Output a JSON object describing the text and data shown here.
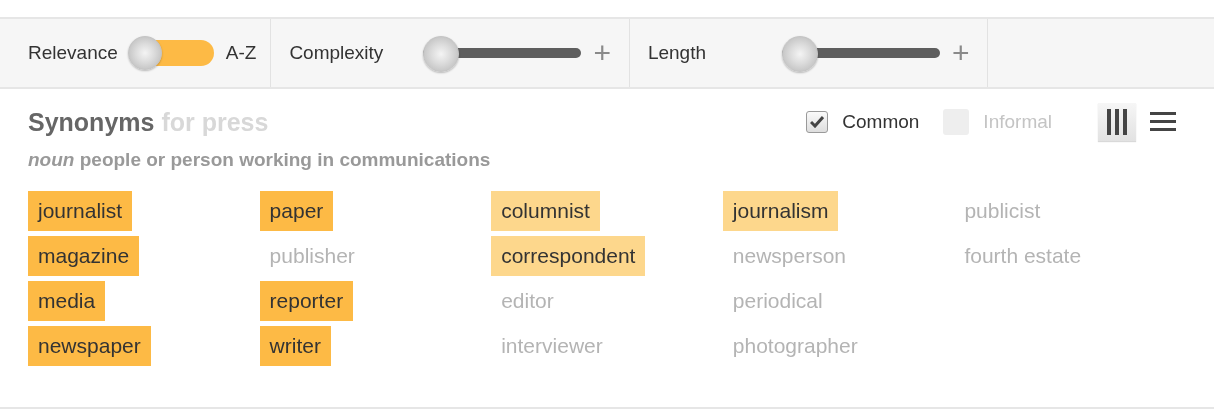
{
  "toolbar": {
    "sort_toggle": {
      "left_label": "Relevance",
      "right_label": "A-Z",
      "on": true
    },
    "sliders": [
      {
        "label": "Complexity",
        "level": 0,
        "plus": "+"
      },
      {
        "label": "Length",
        "level": 0,
        "plus": "+"
      }
    ]
  },
  "heading": {
    "title": "Synonyms",
    "subtitle": "for press"
  },
  "filters": [
    {
      "label": "Common",
      "checked": true
    },
    {
      "label": "Informal",
      "checked": false
    }
  ],
  "view_buttons": [
    {
      "kind": "columns",
      "selected": true
    },
    {
      "kind": "list",
      "selected": false
    }
  ],
  "definition": "*noun* people or person working in communications",
  "word_columns": [
    [
      {
        "text": "journalist",
        "color": "#fdba45"
      },
      {
        "text": "magazine",
        "color": "#fdba45"
      },
      {
        "text": "media",
        "color": "#fdba45"
      },
      {
        "text": "newspaper",
        "color": "#fdba45"
      }
    ],
    [
      {
        "text": "paper",
        "color": "#fdba45"
      },
      {
        "text": "publisher",
        "color": "#b4b4b4"
      },
      {
        "text": "reporter",
        "color": "#fdba45"
      },
      {
        "text": "writer",
        "color": "#fdba45"
      }
    ],
    [
      {
        "text": "columnist",
        "color": "#fdd78c"
      },
      {
        "text": "correspondent",
        "color": "#fdd78c"
      },
      {
        "text": "editor",
        "color": "#b4b4b4"
      },
      {
        "text": "interviewer",
        "color": "#b4b4b4"
      }
    ],
    [
      {
        "text": "journalism",
        "color": "#fdd78c"
      },
      {
        "text": "newsperson",
        "color": "#b4b4b4"
      },
      {
        "text": "periodical",
        "color": "#b4b4b4"
      },
      {
        "text": "photographer",
        "color": "#b4b4b4"
      }
    ],
    [
      {
        "text": "publicist",
        "color": "#b4b4b4"
      },
      {
        "text": "fourth estate",
        "color": "#b4b4b4"
      }
    ]
  ]
}
